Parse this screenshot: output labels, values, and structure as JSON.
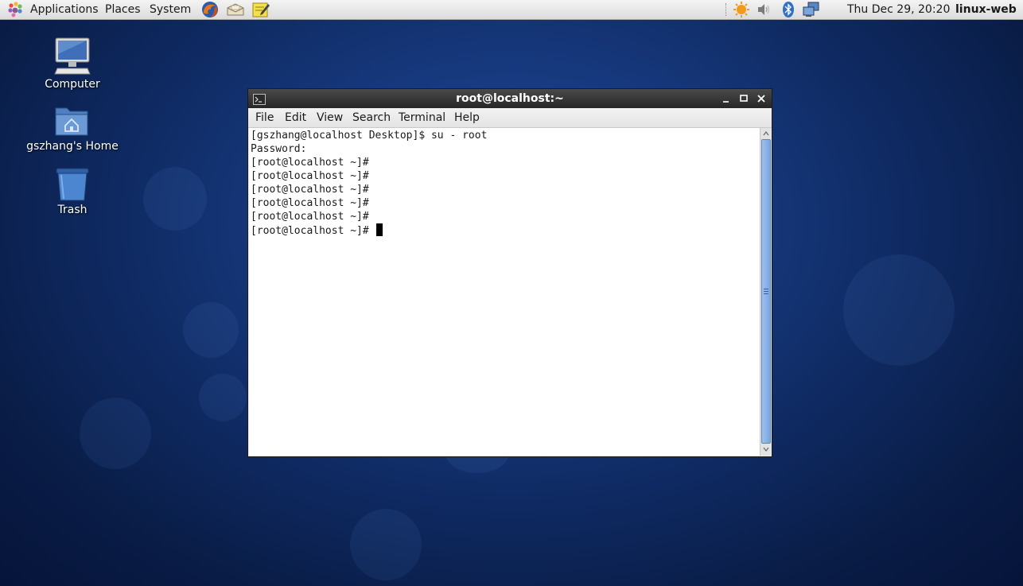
{
  "panel": {
    "menus": [
      "Applications",
      "Places",
      "System"
    ],
    "launchers": [
      "firefox-icon",
      "mail-icon",
      "notes-icon"
    ],
    "tray_icons": [
      "update-icon",
      "volume-icon",
      "bluetooth-icon",
      "network-icon"
    ],
    "clock": "Thu Dec 29, 20:20",
    "hostname": "linux-web"
  },
  "desktop": {
    "icons": [
      {
        "label": "Computer",
        "icon": "computer-icon"
      },
      {
        "label": "gszhang's Home",
        "icon": "home-folder-icon"
      },
      {
        "label": "Trash",
        "icon": "trash-icon"
      }
    ]
  },
  "terminal": {
    "title": "root@localhost:~",
    "menu": [
      "File",
      "Edit",
      "View",
      "Search",
      "Terminal",
      "Help"
    ],
    "lines": [
      "[gszhang@localhost Desktop]$ su - root",
      "Password:",
      "[root@localhost ~]#",
      "[root@localhost ~]#",
      "[root@localhost ~]#",
      "[root@localhost ~]#",
      "[root@localhost ~]#",
      "[root@localhost ~]# "
    ]
  },
  "colors": {
    "desktop_bg": "#0f2a62",
    "titlebar": "#2e2e2e",
    "scroll_thumb": "#8cb3e8"
  }
}
